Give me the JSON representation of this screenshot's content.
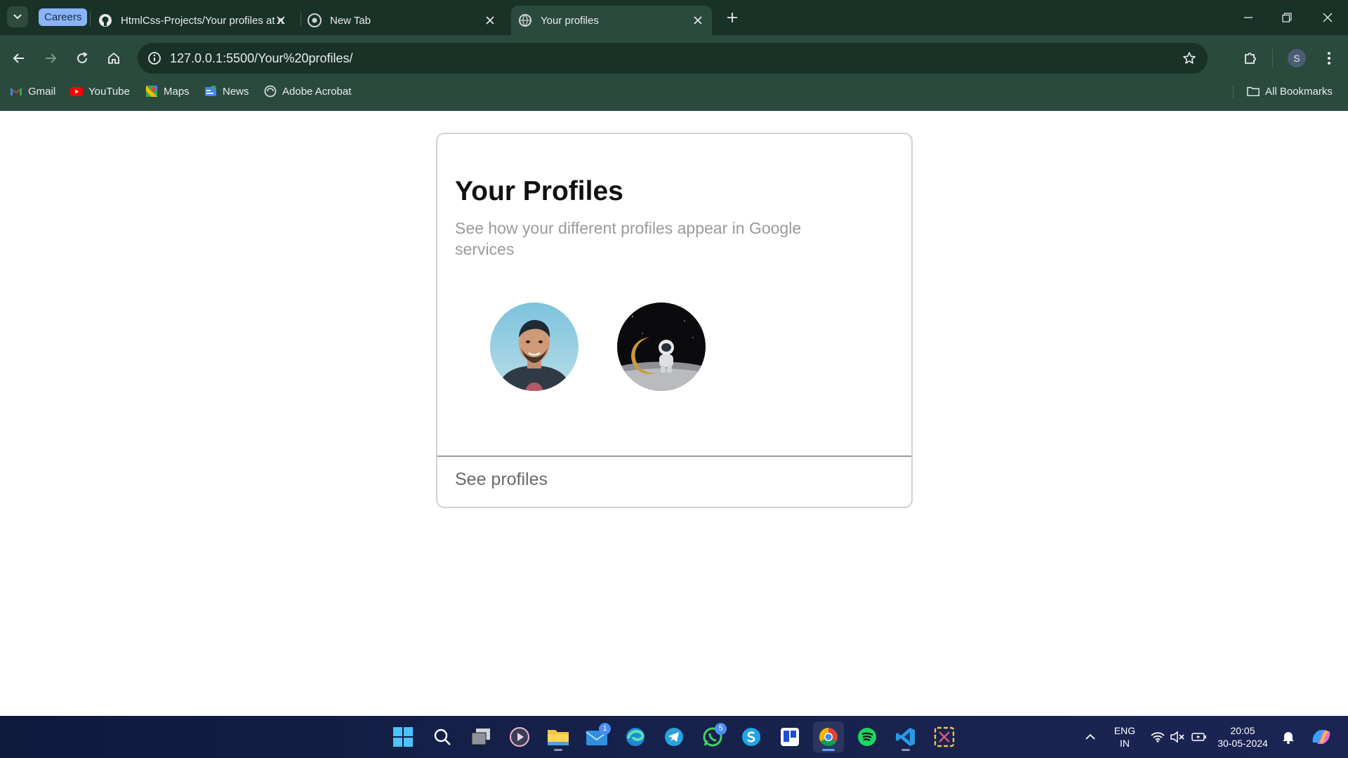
{
  "browser": {
    "tab_group_label": "Careers",
    "tabs": [
      {
        "title": "HtmlCss-Projects/Your profiles at main"
      },
      {
        "title": "New Tab"
      },
      {
        "title": "Your profiles"
      }
    ],
    "url": "127.0.0.1:5500/Your%20profiles/",
    "profile_initial": "S",
    "bookmarks": [
      {
        "label": "Gmail"
      },
      {
        "label": "YouTube"
      },
      {
        "label": "Maps"
      },
      {
        "label": "News"
      },
      {
        "label": "Adobe Acrobat"
      }
    ],
    "all_bookmarks_label": "All Bookmarks"
  },
  "card": {
    "title": "Your Profiles",
    "subtitle": "See how your different profiles appear in Google services",
    "profiles": [
      {
        "icon": "person-photo"
      },
      {
        "icon": "astronaut-moon-photo"
      }
    ],
    "see_profiles_label": "See profiles"
  },
  "taskbar": {
    "mail_badge": "1",
    "whatsapp_badge": "5",
    "language": "ENG",
    "region": "IN",
    "time": "20:05",
    "date": "30-05-2024"
  },
  "colors": {
    "chrome_dark": "#193228",
    "chrome_toolbar": "#2b4a3e",
    "taskbar": "#16214a",
    "accent_blue": "#8ab4f8"
  }
}
